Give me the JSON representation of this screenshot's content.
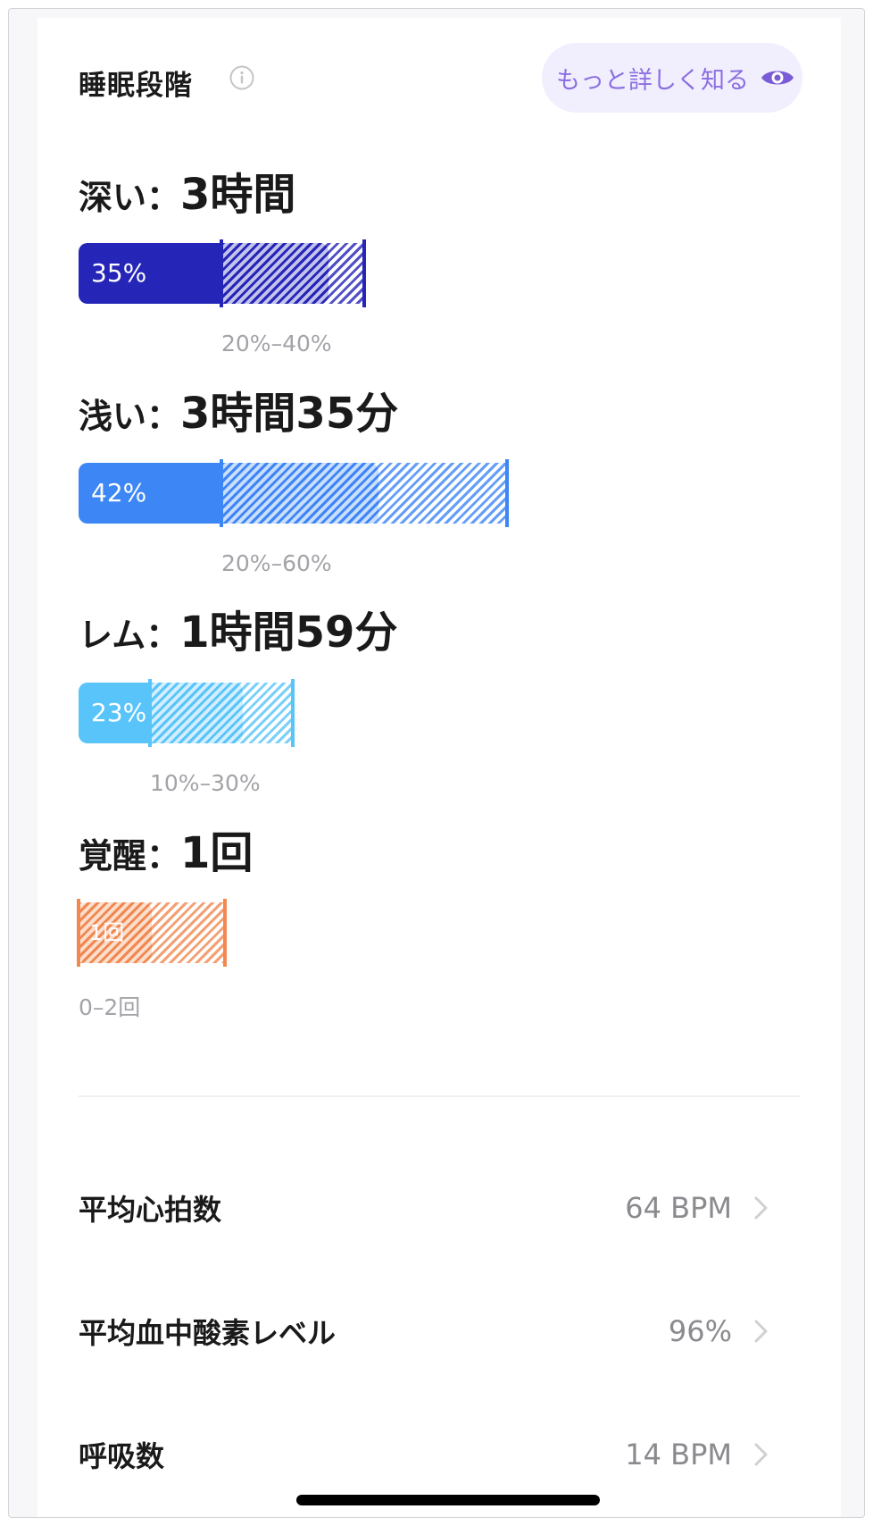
{
  "header": {
    "title": "睡眠段階",
    "learn_more_label": "もっと詳しく知る"
  },
  "stages": [
    {
      "key": "deep",
      "label": "深い：",
      "value": "3時間",
      "percent_label": "35%",
      "percent": 35,
      "range_label": "20%–40%",
      "range": [
        20,
        40
      ],
      "color": "#2525b8"
    },
    {
      "key": "light",
      "label": "浅い：",
      "value": "3時間35分",
      "percent_label": "42%",
      "percent": 42,
      "range_label": "20%–60%",
      "range": [
        20,
        60
      ],
      "color": "#3d86f5"
    },
    {
      "key": "rem",
      "label": "レム：",
      "value": "1時間59分",
      "percent_label": "23%",
      "percent": 23,
      "range_label": "10%–30%",
      "range": [
        10,
        30
      ],
      "color": "#59c4fa"
    },
    {
      "key": "awake",
      "label": "覚醒：",
      "value": "1回",
      "percent_label": "1回",
      "count": 1,
      "range_label": "0–2回",
      "range": [
        0,
        2
      ],
      "color": "#f0884f"
    }
  ],
  "metrics": [
    {
      "label": "平均心拍数",
      "value": "64 BPM"
    },
    {
      "label": "平均血中酸素レベル",
      "value": "96%"
    },
    {
      "label": "呼吸数",
      "value": "14 BPM"
    }
  ]
}
